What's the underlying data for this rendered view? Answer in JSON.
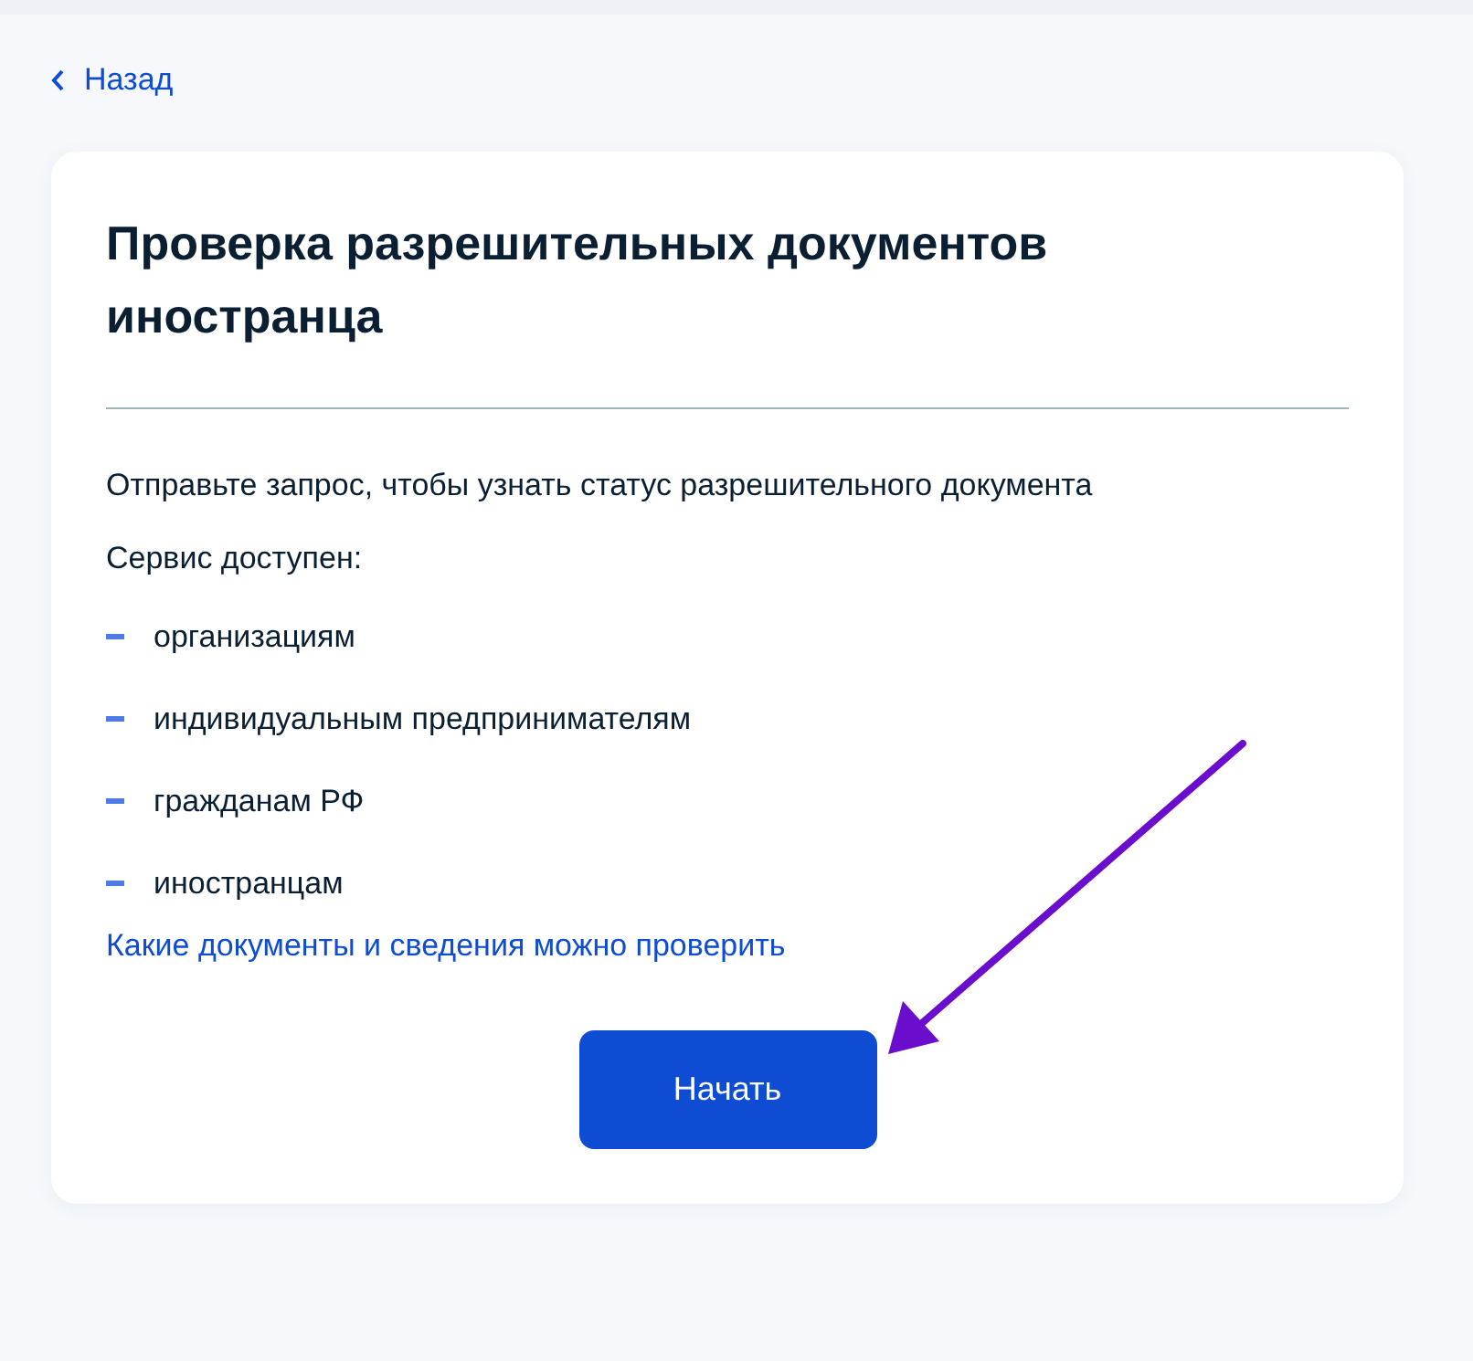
{
  "back_link": {
    "label": "Назад"
  },
  "card": {
    "title": "Проверка разрешительных документов иностранца",
    "description": "Отправьте запрос, чтобы узнать статус разрешительного документа",
    "list_heading": "Сервис доступен:",
    "items": [
      "организациям",
      "индивидуальным предпринимателям",
      "гражданам РФ",
      "иностранцам"
    ],
    "info_link": "Какие документы и сведения можно проверить",
    "start_button": "Начать"
  }
}
